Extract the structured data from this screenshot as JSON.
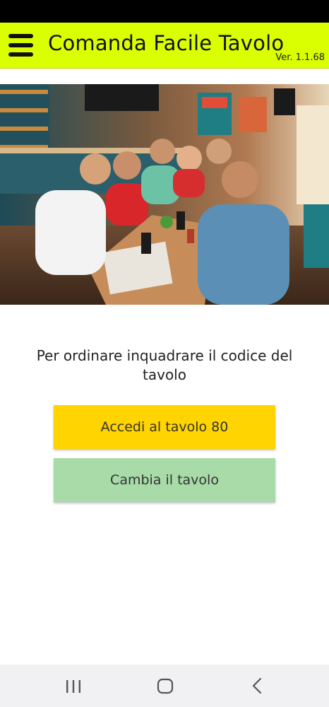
{
  "status_bar": {},
  "app_bar": {
    "title": "Comanda Facile Tavolo",
    "version": "Ver. 1.1.68",
    "menu_icon": "hamburger-menu-icon",
    "background_color": "#d9ff00"
  },
  "hero_image": {
    "depicts": "group of friends at a fast food restaurant table ordering with smartphones"
  },
  "main": {
    "instruction": "Per ordinare inquadrare il codice del tavolo",
    "primary_button": {
      "label": "Accedi al tavolo 80",
      "color": "#ffd400"
    },
    "secondary_button": {
      "label": "Cambia il tavolo",
      "color": "#a8dba8"
    }
  },
  "nav_bar": {
    "items": [
      {
        "icon": "recent-apps-icon"
      },
      {
        "icon": "home-icon"
      },
      {
        "icon": "back-icon"
      }
    ]
  }
}
